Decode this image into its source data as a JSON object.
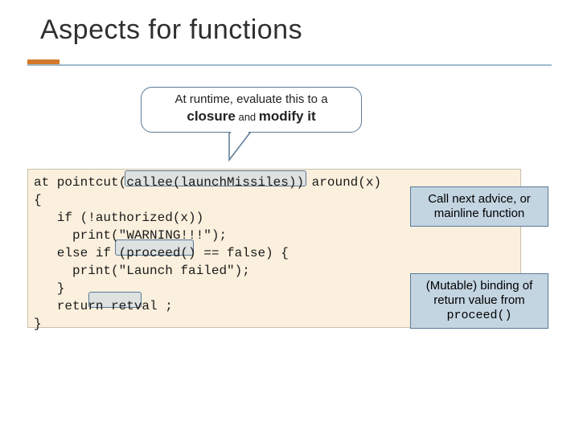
{
  "title": "Aspects for functions",
  "speech": {
    "line1": "At runtime, evaluate this to a",
    "closure": "closure",
    "and": " and ",
    "modify": "modify it"
  },
  "code": {
    "l1a": "at pointcut(",
    "l1b": "callee(launchMissiles)",
    "l1c": ") around(x)",
    "l2": "{",
    "l3": "   if (!authorized(x))",
    "l4": "     print(\"WARNING!!!\");",
    "l5a": "   else if (",
    "l5b": "proceed()",
    "l5c": " == false) {",
    "l6": "     print(\"Launch failed\");",
    "l7": "   }",
    "l8a": "   return ",
    "l8b": "retval",
    "l8c": " ;",
    "l9": "}"
  },
  "annotation1": "Call next advice, or mainline function",
  "annotation2": {
    "a": "(Mutable) binding of return value from ",
    "b": "proceed()"
  }
}
